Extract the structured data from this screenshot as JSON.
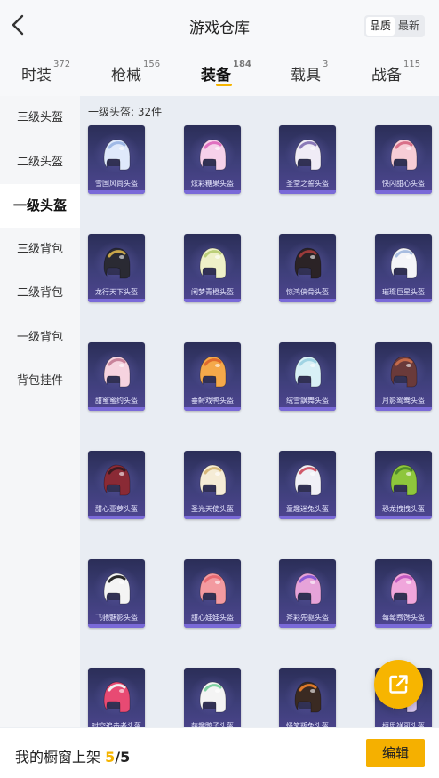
{
  "header": {
    "title": "游戏仓库",
    "sort_options": [
      "品质",
      "最新"
    ],
    "sort_active": "品质"
  },
  "tabs": [
    {
      "label": "时装",
      "count": "372"
    },
    {
      "label": "枪械",
      "count": "156"
    },
    {
      "label": "装备",
      "count": "184",
      "active": true
    },
    {
      "label": "载具",
      "count": "3"
    },
    {
      "label": "战备",
      "count": "115"
    }
  ],
  "sidebar": {
    "items": [
      "三级头盔",
      "二级头盔",
      "一级头盔",
      "三级背包",
      "二级背包",
      "一级背包",
      "背包挂件"
    ],
    "active": "一级头盔"
  },
  "content": {
    "section_label": "一级头盔: 32件",
    "items": [
      {
        "name": "雪国风尚头盔",
        "colors": [
          "#dfe9fb",
          "#9fb9e6"
        ]
      },
      {
        "name": "炫彩糖果头盔",
        "colors": [
          "#f6d1ea",
          "#e070c0"
        ]
      },
      {
        "name": "圣堂之誓头盔",
        "colors": [
          "#f0ecf6",
          "#8b7ab8"
        ]
      },
      {
        "name": "快闪甜心头盔",
        "colors": [
          "#f7cdd6",
          "#d97089"
        ]
      },
      {
        "name": "龙行天下头盔",
        "colors": [
          "#2a2a33",
          "#c9a64a"
        ]
      },
      {
        "name": "闲梦青橙头盔",
        "colors": [
          "#eef0c8",
          "#bccf7a"
        ]
      },
      {
        "name": "惊鸿侠骨头盔",
        "colors": [
          "#2b2326",
          "#9b3a3a"
        ]
      },
      {
        "name": "璀璨巨星头盔",
        "colors": [
          "#f4f4f8",
          "#a9bde0"
        ]
      },
      {
        "name": "甜蜜蜜约头盔",
        "colors": [
          "#f6d3df",
          "#c8839b"
        ]
      },
      {
        "name": "垂鲟戏鸭头盔",
        "colors": [
          "#f5a94a",
          "#e06a2c"
        ]
      },
      {
        "name": "绒雪飘舞头盔",
        "colors": [
          "#d8f0f6",
          "#9fd3e3"
        ]
      },
      {
        "name": "月影鸳鸯头盔",
        "colors": [
          "#6a3a3a",
          "#c46a4a"
        ]
      },
      {
        "name": "甜心亚萝头盔",
        "colors": [
          "#8a2a35",
          "#3a1a20"
        ]
      },
      {
        "name": "圣光天使头盔",
        "colors": [
          "#f5ecd6",
          "#d7b87a"
        ]
      },
      {
        "name": "童趣迷兔头盔",
        "colors": [
          "#f0f0f6",
          "#d0596a"
        ]
      },
      {
        "name": "恐龙拽拽头盔",
        "colors": [
          "#8ec63c",
          "#4f8a2a"
        ]
      },
      {
        "name": "飞驰魅影头盔",
        "colors": [
          "#f4f4f4",
          "#2a2a2a"
        ]
      },
      {
        "name": "甜心娃娃头盔",
        "colors": [
          "#f39aa0",
          "#e86a72"
        ]
      },
      {
        "name": "斧彩先驱头盔",
        "colors": [
          "#e6a3d9",
          "#8a5bd6"
        ]
      },
      {
        "name": "莓莓煦馋头盔",
        "colors": [
          "#f0a6dc",
          "#c25ac0"
        ]
      },
      {
        "name": "时空追击者头盔",
        "colors": [
          "#e84a73",
          "#f0f0f0"
        ]
      },
      {
        "name": "萌趣鸭子头盔",
        "colors": [
          "#f4f4f4",
          "#7cd0a0"
        ]
      },
      {
        "name": "怪笑叛兔头盔",
        "colors": [
          "#3a2a22",
          "#e07a2a"
        ]
      },
      {
        "name": "桓思祥哥头盔",
        "colors": [
          "#d8c6f0",
          "#9f87d8"
        ]
      }
    ]
  },
  "bottom_bar": {
    "label": "我的橱窗上架",
    "count": "5",
    "total": "/5",
    "edit_label": "编辑"
  },
  "fab": {
    "icon": "share-external-icon"
  },
  "accent_color": "#f5b400"
}
